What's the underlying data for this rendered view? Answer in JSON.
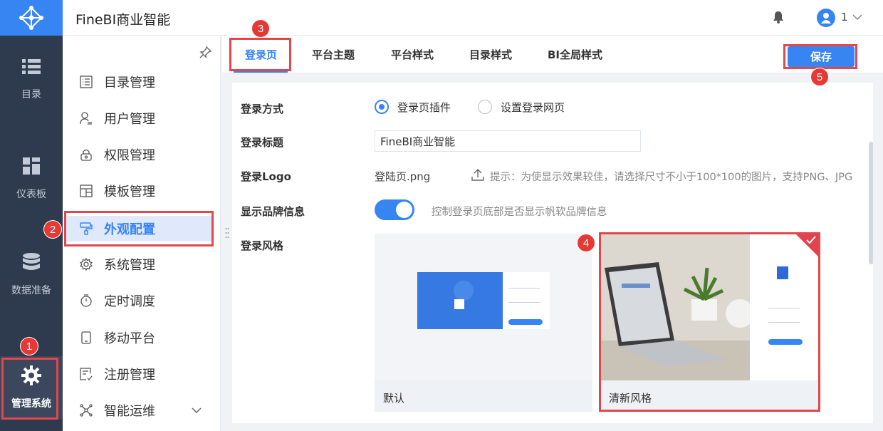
{
  "header": {
    "app_title": "FineBI商业智能",
    "user_name": "1"
  },
  "leftnav": {
    "items": [
      {
        "label": "目录",
        "icon": "list-icon"
      },
      {
        "label": "仪表板",
        "icon": "dashboard-icon"
      },
      {
        "label": "数据准备",
        "icon": "database-icon"
      },
      {
        "label": "管理系统",
        "icon": "gear-icon"
      }
    ]
  },
  "sidebar": {
    "items": [
      {
        "label": "目录管理"
      },
      {
        "label": "用户管理"
      },
      {
        "label": "权限管理"
      },
      {
        "label": "模板管理"
      },
      {
        "label": "外观配置"
      },
      {
        "label": "系统管理"
      },
      {
        "label": "定时调度"
      },
      {
        "label": "移动平台"
      },
      {
        "label": "注册管理"
      },
      {
        "label": "智能运维"
      }
    ]
  },
  "tabs": [
    "登录页",
    "平台主题",
    "平台样式",
    "目录样式",
    "BI全局样式"
  ],
  "save_label": "保存",
  "form": {
    "login_method": {
      "label": "登录方式",
      "option1": "登录页插件",
      "option2": "设置登录网页"
    },
    "login_title": {
      "label": "登录标题",
      "value": "FineBI商业智能"
    },
    "login_logo": {
      "label": "登录Logo",
      "file": "登陆页.png",
      "hint": "提示：为使显示效果较佳，请选择尺寸不小于100*100的图片，支持PNG、JPG"
    },
    "show_brand": {
      "label": "显示品牌信息",
      "desc": "控制登录页底部是否显示帆软品牌信息"
    },
    "login_style": {
      "label": "登录风格",
      "option_default": "默认",
      "option_fresh": "清新风格"
    }
  },
  "annotations": [
    "1",
    "2",
    "3",
    "4",
    "5"
  ],
  "colors": {
    "accent": "#3685f2",
    "nav_bg": "#2e3a4d",
    "highlight": "#e2474c"
  }
}
